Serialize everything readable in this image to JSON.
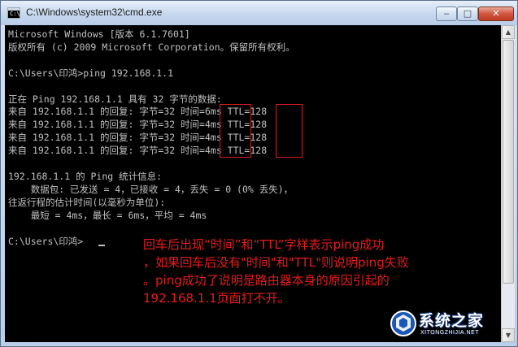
{
  "window": {
    "title": "C:\\Windows\\system32\\cmd.exe",
    "icon_text": "C:\\",
    "buttons": {
      "minimize": "‒",
      "maximize": "□",
      "close": "✕"
    }
  },
  "console": {
    "lines": [
      "Microsoft Windows [版本 6.1.7601]",
      "版权所有 (c) 2009 Microsoft Corporation。保留所有权利。",
      "",
      "C:\\Users\\印鸿>ping 192.168.1.1",
      "",
      "正在 Ping 192.168.1.1 具有 32 字节的数据:",
      "来自 192.168.1.1 的回复: 字节=32 时间=6ms TTL=128",
      "来自 192.168.1.1 的回复: 字节=32 时间=4ms TTL=128",
      "来自 192.168.1.1 的回复: 字节=32 时间=4ms TTL=128",
      "来自 192.168.1.1 的回复: 字节=32 时间=4ms TTL=128",
      "",
      "192.168.1.1 的 Ping 统计信息:",
      "    数据包: 已发送 = 4，已接收 = 4，丢失 = 0 (0% 丢失)，",
      "往返行程的估计时间(以毫秒为单位):",
      "    最短 = 4ms，最长 = 6ms，平均 = 4ms",
      "",
      "C:\\Users\\印鸿>"
    ]
  },
  "annotation": {
    "lines": [
      "回车后出现“时间”和“TTL”字样表示ping成功",
      "，如果回车后没有\"时间\"和\"TTL\"则说明ping失败",
      "。ping成功了说明是路由器本身的原因引起的",
      "192.168.1.1页面打不开。"
    ]
  },
  "scrollbar": {
    "up": "▲",
    "down": "▼"
  },
  "watermark": {
    "brand": "系统之家",
    "url": "XITONGZHIJIA.NET"
  },
  "colors": {
    "console_bg": "#000000",
    "console_text": "#c0c0c0",
    "annotation": "#e21d1d",
    "highlight_box": "#d21d1d"
  }
}
